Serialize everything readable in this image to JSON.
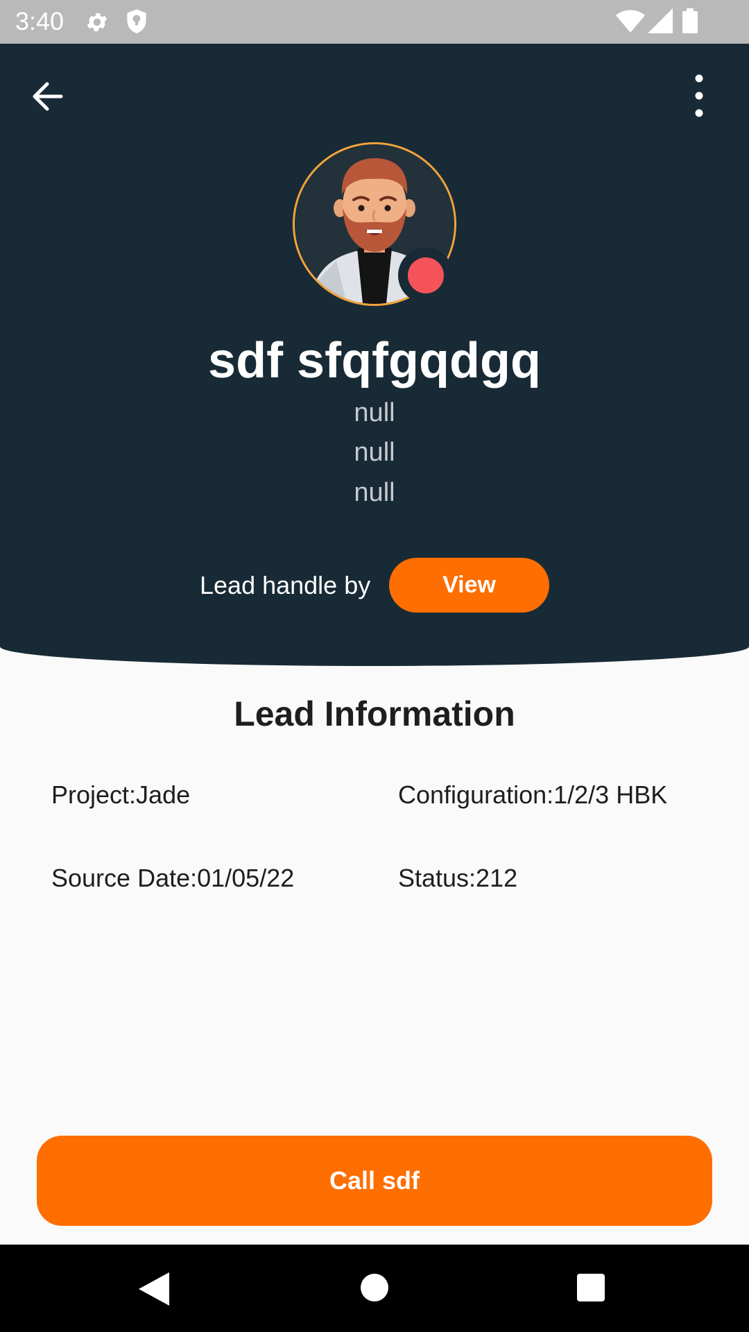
{
  "status_bar": {
    "time": "3:40",
    "icons": [
      "gear-icon",
      "shield-icon",
      "wifi-icon",
      "signal-icon",
      "battery-icon"
    ]
  },
  "header": {
    "back_icon": "arrow-left-icon",
    "menu_icon": "more-vertical-icon",
    "avatar": "avatar-man-beard",
    "status_dot_color": "#f4535a",
    "name": "sdf sfqfgqdgq",
    "lines": [
      "null",
      "null",
      "null"
    ],
    "handle_label": "Lead handle by",
    "view_button": "View"
  },
  "lead_info": {
    "title": "Lead Information",
    "project": "Project:Jade",
    "configuration": "Configuration:1/2/3 HBK",
    "source_date": "Source Date:01/05/22",
    "status": "Status:212"
  },
  "call_button": "Call sdf",
  "colors": {
    "header_bg": "#182a35",
    "accent": "#fe6e00",
    "avatar_ring": "#f3a33b"
  },
  "nav_bar": {
    "icons": [
      "nav-back-icon",
      "nav-home-icon",
      "nav-recents-icon"
    ]
  }
}
